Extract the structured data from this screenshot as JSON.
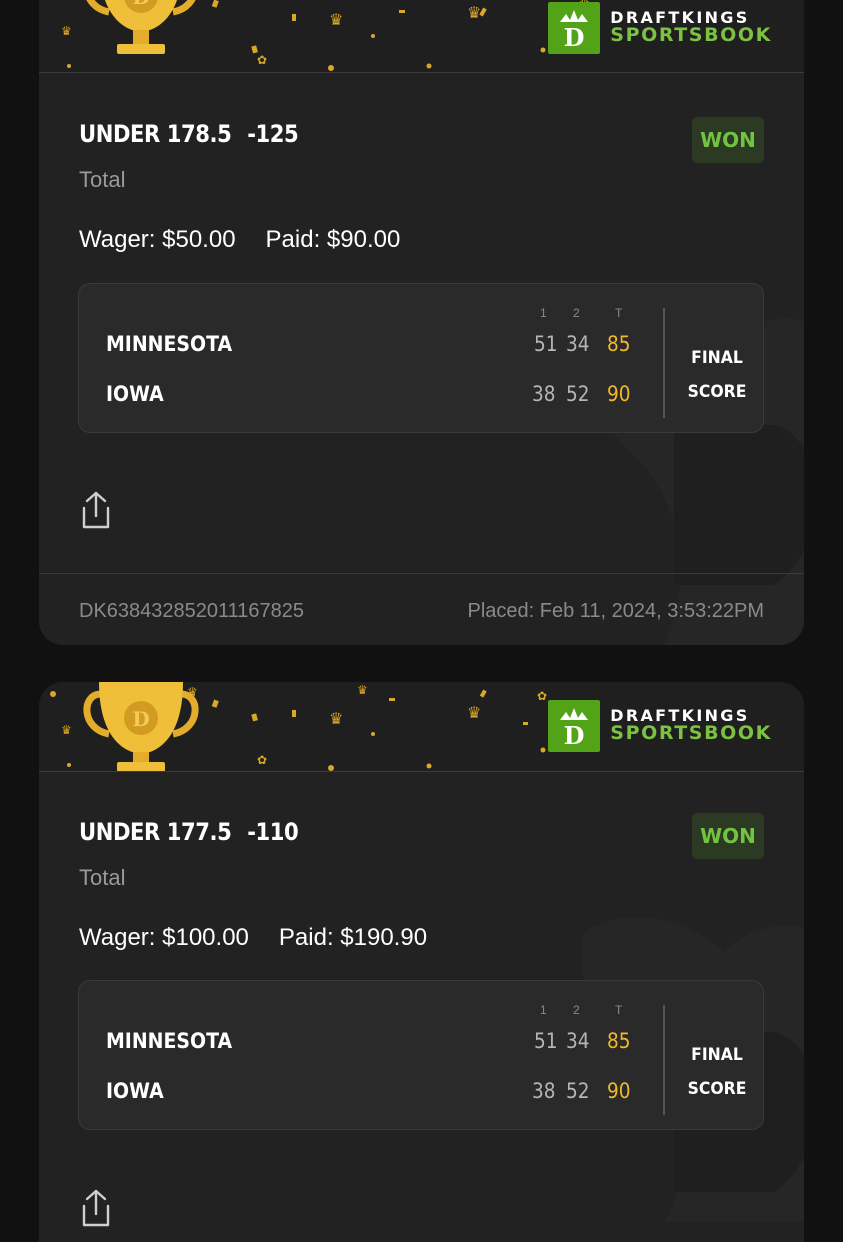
{
  "brand": {
    "line1": "DRAFTKINGS",
    "line2": "SPORTSBOOK"
  },
  "colors": {
    "accent_green": "#53a318",
    "won_green": "#71c43f",
    "total_gold": "#f0b92c",
    "card_bg": "#222222"
  },
  "score_headers": [
    "1",
    "2",
    "T"
  ],
  "final_label": [
    "FINAL",
    "SCORE"
  ],
  "bets": [
    {
      "selection": "UNDER 178.5",
      "odds": "-125",
      "bet_type": "Total",
      "status": "WON",
      "wager_label": "Wager:",
      "wager": "$50.00",
      "paid_label": "Paid:",
      "paid": "$90.00",
      "teams": [
        {
          "name": "MINNESOTA",
          "p1": "51",
          "p2": "34",
          "total": "85"
        },
        {
          "name": "IOWA",
          "p1": "38",
          "p2": "52",
          "total": "90"
        }
      ],
      "ticket_id": "DK638432852011167825",
      "placed": "Placed: Feb 11, 2024, 3:53:22PM"
    },
    {
      "selection": "UNDER 177.5",
      "odds": "-110",
      "bet_type": "Total",
      "status": "WON",
      "wager_label": "Wager:",
      "wager": "$100.00",
      "paid_label": "Paid:",
      "paid": "$190.90",
      "teams": [
        {
          "name": "MINNESOTA",
          "p1": "51",
          "p2": "34",
          "total": "85"
        },
        {
          "name": "IOWA",
          "p1": "38",
          "p2": "52",
          "total": "90"
        }
      ]
    }
  ]
}
